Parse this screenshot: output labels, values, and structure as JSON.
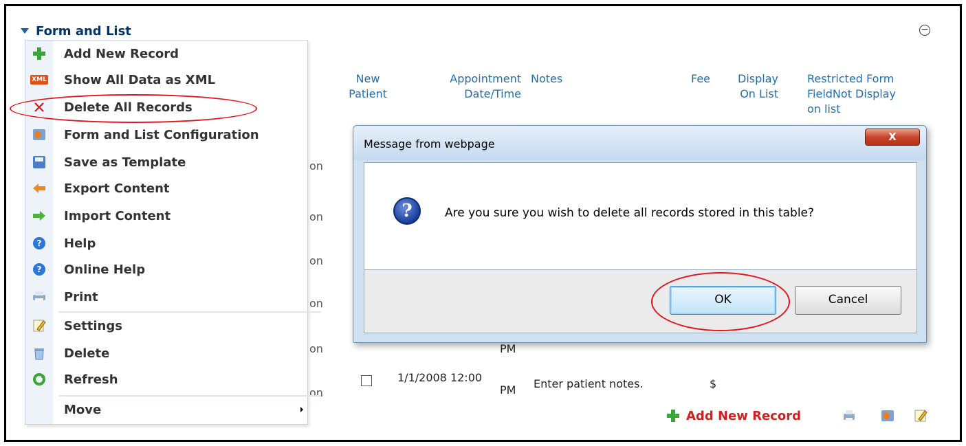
{
  "module": {
    "title": "Form and List"
  },
  "menu": {
    "items": [
      {
        "label": "Add New Record",
        "icon": "plus-icon"
      },
      {
        "label": "Show All Data as XML",
        "icon": "xml-icon",
        "badge": "XML"
      },
      {
        "label": "Delete All Records",
        "icon": "x-icon"
      },
      {
        "label": "Form and List Configuration",
        "icon": "config-icon"
      },
      {
        "label": "Save as Template",
        "icon": "save-icon"
      },
      {
        "label": "Export Content",
        "icon": "export-arrow-icon"
      },
      {
        "label": "Import Content",
        "icon": "import-arrow-icon"
      },
      {
        "label": "Help",
        "icon": "help-icon"
      },
      {
        "label": "Online Help",
        "icon": "help-icon"
      },
      {
        "label": "Print",
        "icon": "print-icon"
      },
      {
        "label": "Settings",
        "icon": "settings-pencil-icon"
      },
      {
        "label": "Delete",
        "icon": "trash-icon"
      },
      {
        "label": "Refresh",
        "icon": "refresh-icon"
      },
      {
        "label": "Move",
        "icon": "none",
        "has_submenu": true
      }
    ]
  },
  "table": {
    "headers": {
      "new_patient": "New Patient",
      "new_patient_l1": "New",
      "new_patient_l2": "Patient",
      "appt_l1": "Appointment",
      "appt_l2": "Date/Time",
      "notes": "Notes",
      "fee": "Fee",
      "display_l1": "Display",
      "display_l2": "On List",
      "restricted_l1": "Restricted Form",
      "restricted_l2": "FieldNot Display",
      "restricted_l3": "on list"
    },
    "row_fragment": "on",
    "visible_rows": [
      {
        "time_tail": "PM"
      },
      {
        "date": "1/1/2008 12:00",
        "time_tail": "PM",
        "notes": "Enter patient notes.",
        "fee": "$"
      }
    ]
  },
  "footer": {
    "add_new_label": "Add New Record"
  },
  "dialog": {
    "title": "Message from webpage",
    "close_glyph": "X",
    "message": "Are you sure you wish to delete all records stored in this table?",
    "ok_label": "OK",
    "cancel_label": "Cancel",
    "question_glyph": "?"
  },
  "colors": {
    "accent": "#1f6fb0",
    "highlight_ellipse": "#e2141c",
    "footer_link": "#d02020"
  }
}
